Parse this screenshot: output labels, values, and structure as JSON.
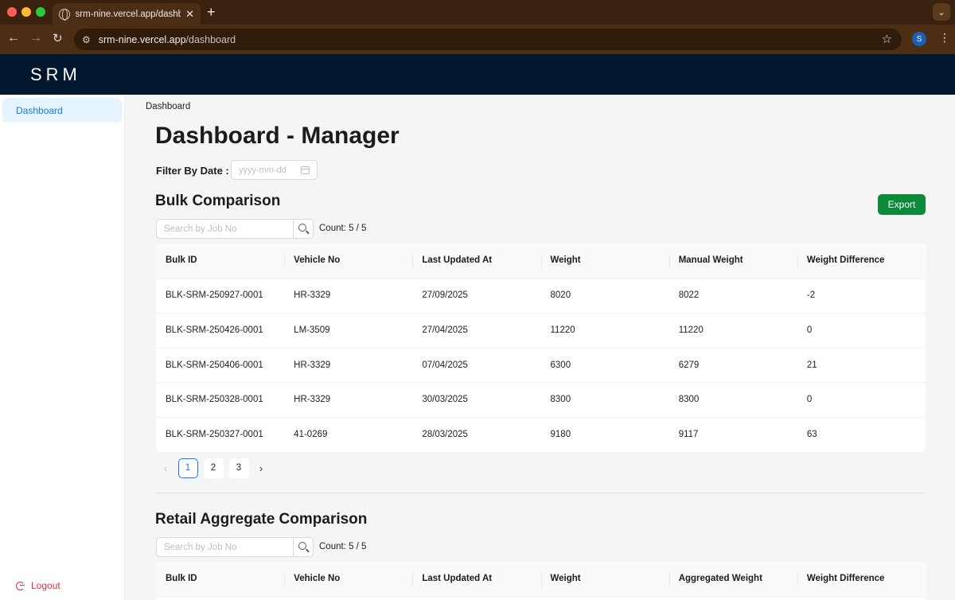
{
  "browser": {
    "tab_title": "srm-nine.vercel.app/dashboard",
    "url_host": "srm-nine.vercel.app",
    "url_path": "/dashboard",
    "profile_initial": "S"
  },
  "app": {
    "logo": "SRM"
  },
  "sidebar": {
    "items": [
      {
        "label": "Dashboard",
        "active": true
      }
    ],
    "logout_label": "Logout"
  },
  "breadcrumb": "Dashboard",
  "page_title": "Dashboard - Manager",
  "filter": {
    "label": "Filter By Date :",
    "date_placeholder": "yyyy-mm-dd"
  },
  "bulk": {
    "title": "Bulk Comparison",
    "export_label": "Export",
    "search_placeholder": "Search by Job No",
    "count": "Count: 5 / 5",
    "columns": [
      "Bulk ID",
      "Vehicle No",
      "Last Updated At",
      "Weight",
      "Manual Weight",
      "Weight Difference"
    ],
    "rows": [
      [
        "BLK-SRM-250927-0001",
        "HR-3329",
        "27/09/2025",
        "8020",
        "8022",
        "-2"
      ],
      [
        "BLK-SRM-250426-0001",
        "LM-3509",
        "27/04/2025",
        "11220",
        "11220",
        "0"
      ],
      [
        "BLK-SRM-250406-0001",
        "HR-3329",
        "07/04/2025",
        "6300",
        "6279",
        "21"
      ],
      [
        "BLK-SRM-250328-0001",
        "HR-3329",
        "30/03/2025",
        "8300",
        "8300",
        "0"
      ],
      [
        "BLK-SRM-250327-0001",
        "41-0269",
        "28/03/2025",
        "9180",
        "9117",
        "63"
      ]
    ],
    "pagination": {
      "pages": [
        "1",
        "2",
        "3"
      ],
      "current": "1",
      "prev": "‹",
      "next": "›"
    }
  },
  "retail": {
    "title": "Retail Aggregate Comparison",
    "search_placeholder": "Search by Job No",
    "count": "Count: 5 / 5",
    "columns": [
      "Bulk ID",
      "Vehicle No",
      "Last Updated At",
      "Weight",
      "Aggregated Weight",
      "Weight Difference"
    ]
  },
  "colors": {
    "header_bg": "#00172d",
    "accent": "#1677ff",
    "export_green": "#0b8a3a",
    "logout_red": "#e0303f"
  }
}
